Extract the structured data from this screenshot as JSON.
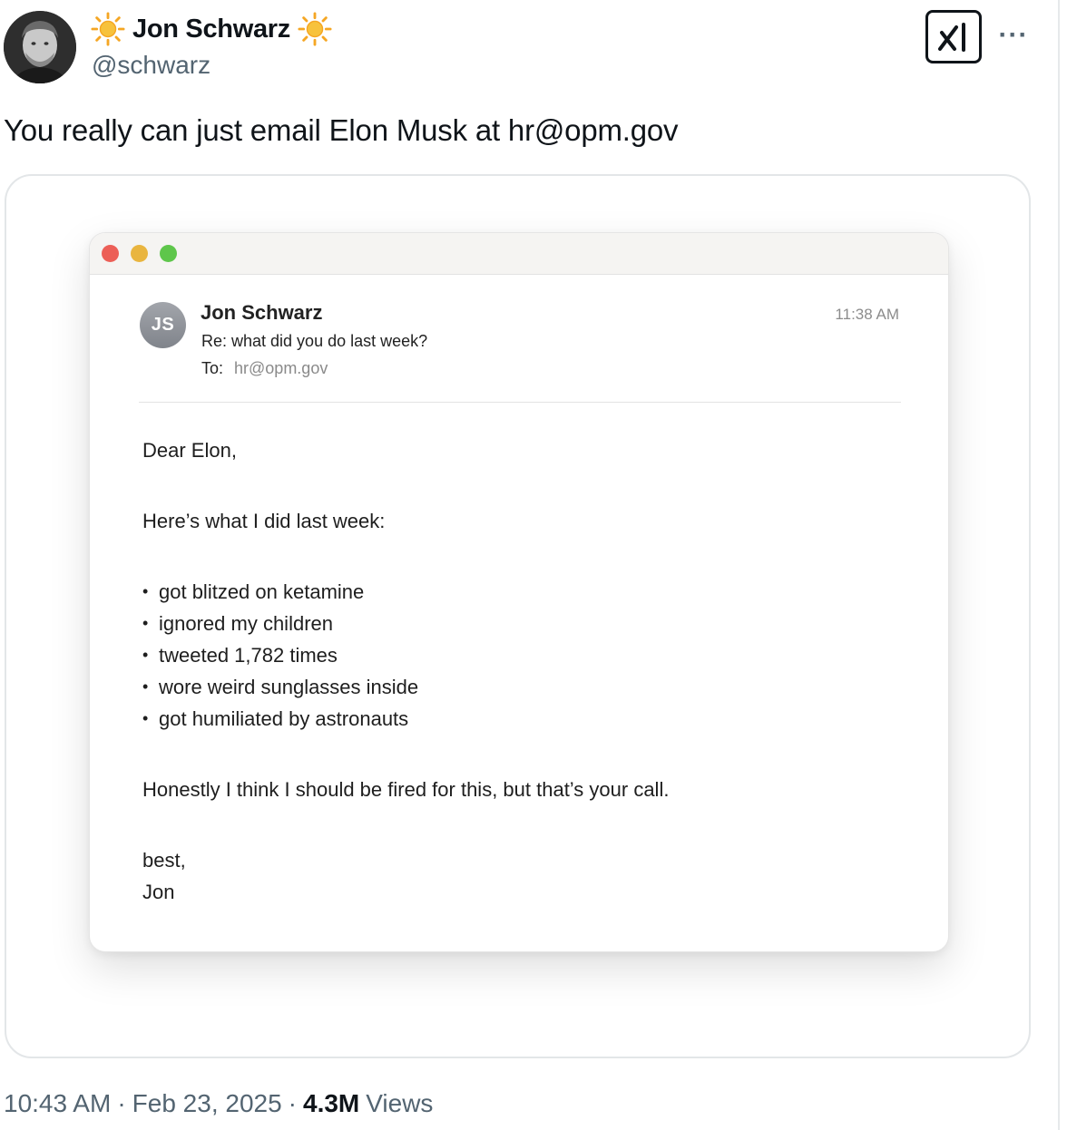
{
  "author": {
    "display_name": "Jon Schwarz",
    "handle": "@schwarz",
    "name_decoration_icon": "sun-emoji"
  },
  "actions": {
    "grok_icon": "grok-icon",
    "more_label": "···"
  },
  "tweet": {
    "text": "You really can just email Elon Musk at hr@opm.gov"
  },
  "email": {
    "sender_initials": "JS",
    "sender_name": "Jon Schwarz",
    "subject": "Re: what did you do last week?",
    "to_label": "To:",
    "to_address": "hr@opm.gov",
    "time": "11:38 AM",
    "greeting": "Dear Elon,",
    "intro": "Here’s what I did last week:",
    "bullets": [
      "got blitzed on ketamine",
      "ignored my children",
      "tweeted 1,782 times",
      "wore weird sunglasses inside",
      "got humiliated by astronauts"
    ],
    "closing_line": "Honestly I think I should be fired for this, but that’s your call.",
    "signoff": "best,",
    "signature": "Jon"
  },
  "meta": {
    "time": "10:43 AM",
    "separator": "·",
    "date": "Feb 23, 2025",
    "views_count": "4.3M",
    "views_label": "Views"
  }
}
